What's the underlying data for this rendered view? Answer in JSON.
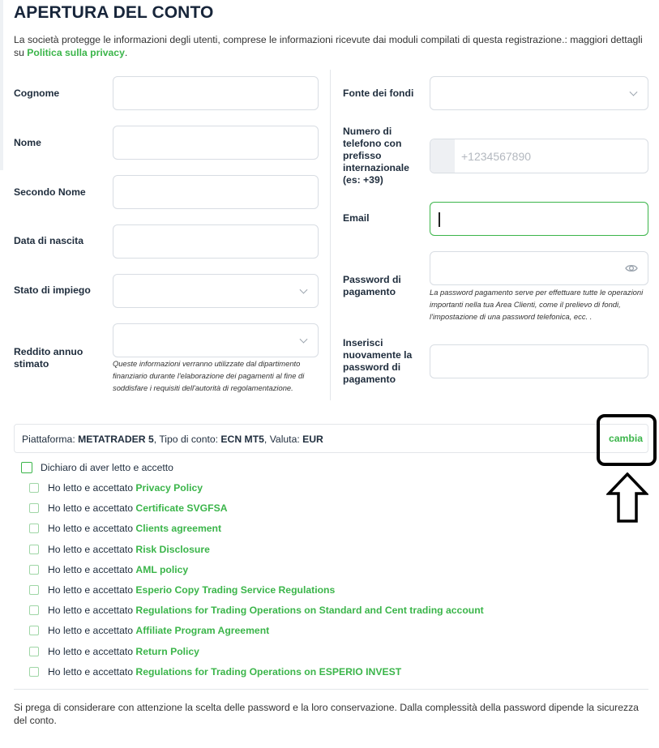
{
  "page": {
    "title": "APERTURA DEL CONTO",
    "intro_text": "La società protegge le informazioni degli utenti, comprese le informazioni ricevute dai moduli compilati di questa registrazione.: maggiori dettagli su ",
    "privacy_link": "Politica sulla privacy",
    "intro_end": "."
  },
  "left_fields": {
    "surname_label": "Cognome",
    "name_label": "Nome",
    "middle_name_label": "Secondo Nome",
    "birth_date_label": "Data di nascita",
    "employment_label": "Stato di impiego",
    "income_label": "Reddito annuo stimato",
    "income_help": "Queste informazioni verranno utilizzate dal dipartimento finanziario durante l'elaborazione dei pagamenti al fine di soddisfare i requisiti dell'autorità di regolamentazione."
  },
  "right_fields": {
    "funds_source_label": "Fonte dei fondi",
    "phone_label": "Numero di telefono con prefisso internazionale (es: +39)",
    "phone_placeholder": "+1234567890",
    "email_label": "Email",
    "email_value": "",
    "payment_password_label": "Password di pagamento",
    "payment_password_help": "La password pagamento serve per effettuare tutte le operazioni importanti nella tua Area Clienti, come il prelievo di fondi, l'impostazione di una password telefonica, ecc. .",
    "repeat_password_label": "Inserisci nuovamente la password di pagamento"
  },
  "platform_bar": {
    "platform_prefix": "Piattaforma: ",
    "platform_value": "METATRADER 5",
    "account_prefix": ", Tipo di conto: ",
    "account_value": "ECN MT5",
    "currency_prefix": ", Valuta: ",
    "currency_value": "EUR",
    "change_link": "cambia"
  },
  "agreements": {
    "master_label": "Dichiaro di aver letto e accetto",
    "item_prefix": "Ho letto e accettato",
    "items": [
      {
        "link": "Privacy Policy",
        "checked": false
      },
      {
        "link": "Certificate SVGFSA",
        "checked": false
      },
      {
        "link": "Clients agreement",
        "checked": false
      },
      {
        "link": "Risk Disclosure",
        "checked": false
      },
      {
        "link": "AML policy",
        "checked": false
      },
      {
        "link": "Esperio Copy Trading Service Regulations",
        "checked": false
      },
      {
        "link": "Regulations for Trading Operations on Standard and Cent trading account",
        "checked": false
      },
      {
        "link": "Affiliate Program Agreement",
        "checked": false
      },
      {
        "link": "Return Policy",
        "checked": false
      },
      {
        "link": "Regulations for Trading Operations on ESPERIO INVEST",
        "checked": false
      }
    ]
  },
  "footer": {
    "text": "Si prega di considerare con attenzione la scelta delle password e la loro conservazione. Dalla complessità della password dipende la sicurezza del conto."
  },
  "colors": {
    "accent": "#3bb54a",
    "text": "#1f2d3d",
    "border": "#d8dde3"
  }
}
